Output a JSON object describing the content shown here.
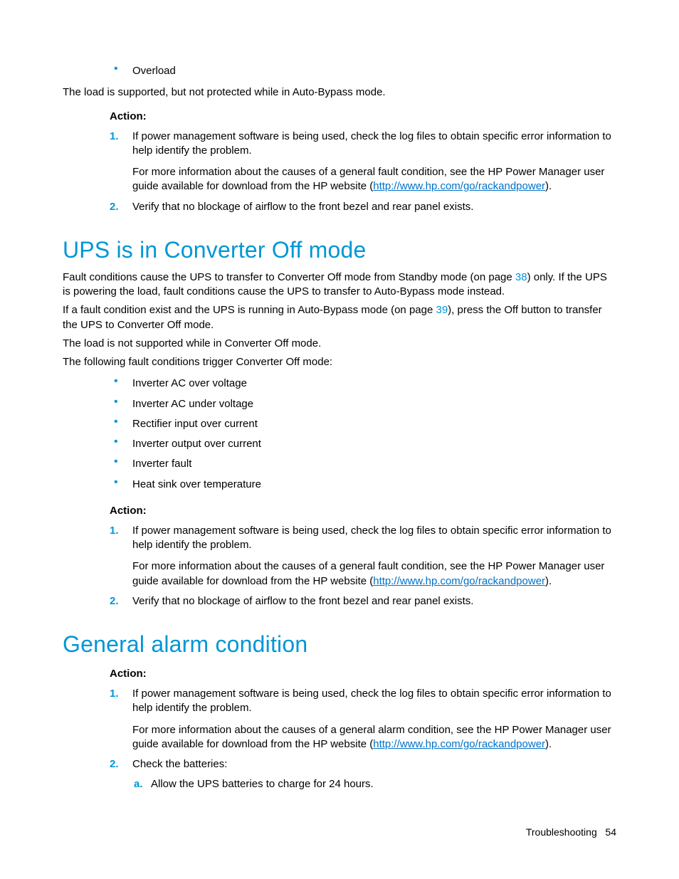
{
  "colors": {
    "accent": "#0096d6",
    "link": "#0072c6"
  },
  "top": {
    "bullet_overload": "Overload",
    "para_supported": "The load is supported, but not protected while in Auto-Bypass mode.",
    "action_label": "Action",
    "action_colon": ":",
    "step1_a": "If power management software is being used, check the log files to obtain specific error information to help identify the problem.",
    "step1_b_pre": "For more information about the causes of a general fault condition, see the HP Power Manager user guide available for download from the HP website (",
    "step1_b_link": "http://www.hp.com/go/rackandpower",
    "step1_b_post": ").",
    "step2": "Verify that no blockage of airflow to the front bezel and rear panel exists."
  },
  "converter": {
    "heading": "UPS is in Converter Off mode",
    "p1_a": "Fault conditions cause the UPS to transfer to Converter Off mode from Standby mode (on page ",
    "p1_ref": "38",
    "p1_b": ") only. If the UPS is powering the load, fault conditions cause the UPS to transfer to Auto-Bypass mode instead.",
    "p2_a": "If a fault condition exist and the UPS is running in Auto-Bypass mode (on page ",
    "p2_ref": "39",
    "p2_b": "), press the Off button to transfer the UPS to Converter Off mode.",
    "p3": "The load is not supported while in Converter Off mode.",
    "p4": "The following fault conditions trigger Converter Off mode:",
    "faults": [
      "Inverter AC over voltage",
      "Inverter AC under voltage",
      "Rectifier input over current",
      "Inverter output over current",
      "Inverter fault",
      "Heat sink over temperature"
    ],
    "action_label": "Action:",
    "step1_a": "If power management software is being used, check the log files to obtain specific error information to help identify the problem.",
    "step1_b_pre": "For more information about the causes of a general fault condition, see the HP Power Manager user guide available for download from the HP website (",
    "step1_b_link": "http://www.hp.com/go/rackandpower",
    "step1_b_post": ").",
    "step2": "Verify that no blockage of airflow to the front bezel and rear panel exists."
  },
  "alarm": {
    "heading": "General alarm condition",
    "action_label": "Action",
    "action_colon": ":",
    "step1_a": "If power management software is being used, check the log files to obtain specific error information to help identify the problem.",
    "step1_b_pre": "For more information about the causes of a general alarm condition, see the HP Power Manager user guide available for download from the HP website (",
    "step1_b_link": "http://www.hp.com/go/rackandpower",
    "step1_b_post": ").",
    "step2": "Check the batteries:",
    "step2_a": "Allow the UPS batteries to charge for 24 hours."
  },
  "footer": {
    "section": "Troubleshooting",
    "page": "54"
  }
}
